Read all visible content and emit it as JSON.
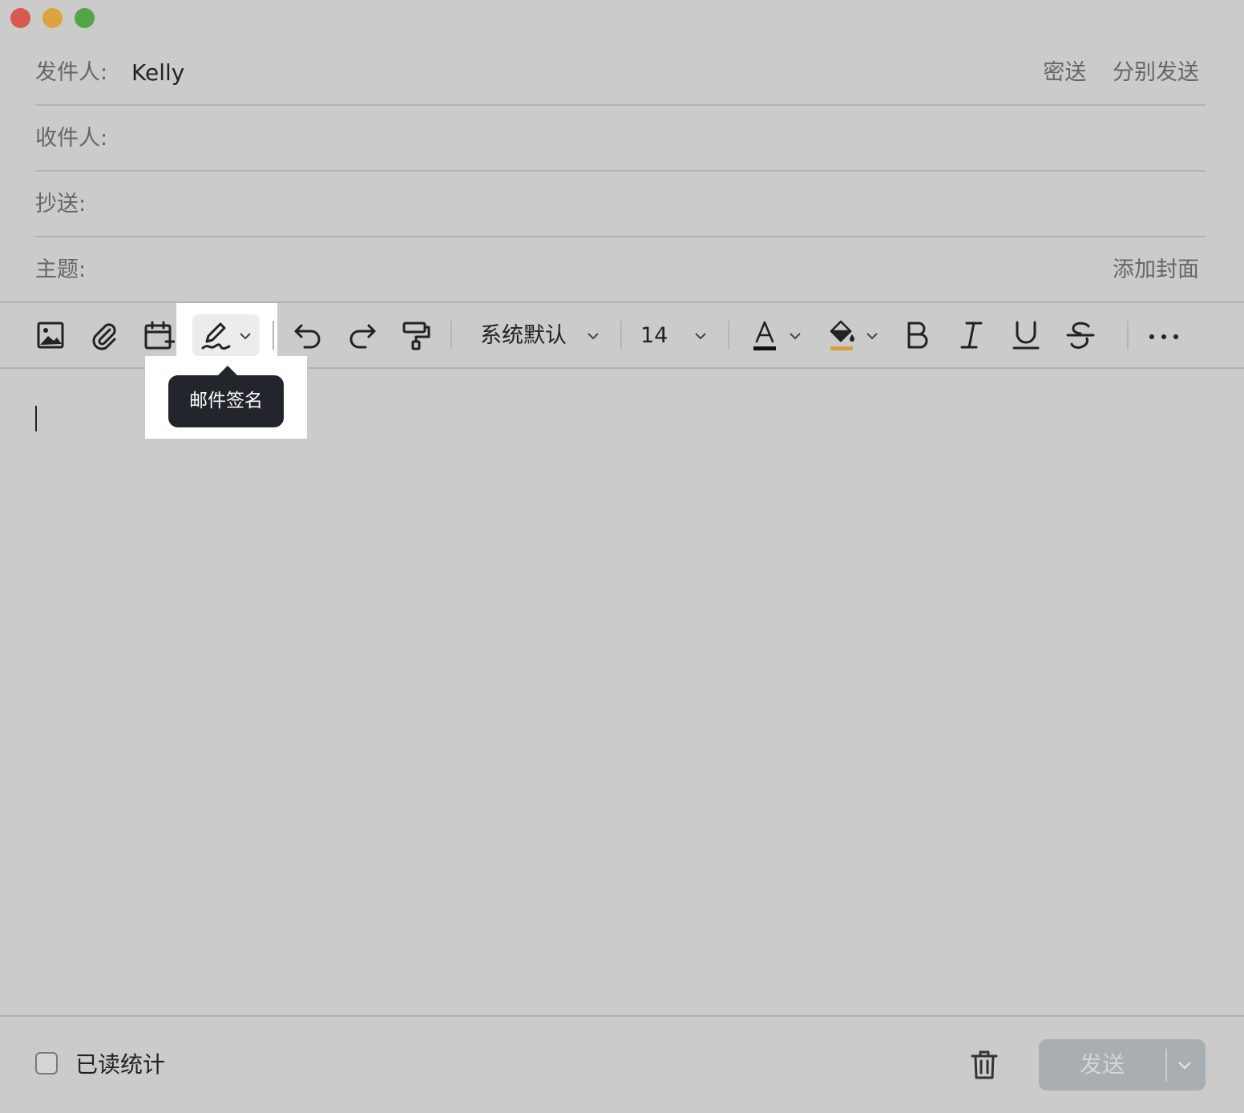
{
  "window": {
    "controls": [
      "close",
      "minimize",
      "maximize"
    ]
  },
  "header": {
    "from_label": "发件人:",
    "from_value": "Kelly",
    "bcc_link": "密送",
    "separate_send_link": "分别发送",
    "to_label": "收件人:",
    "cc_label": "抄送:",
    "subject_label": "主题:",
    "add_cover_link": "添加封面"
  },
  "toolbar": {
    "icons": [
      "image-icon",
      "attachment-icon",
      "calendar-add-icon",
      "signature-icon",
      "undo-icon",
      "redo-icon",
      "format-painter-icon",
      "font-color-icon",
      "highlight-icon",
      "bold-icon",
      "italic-icon",
      "underline-icon",
      "strikethrough-icon",
      "more-icon"
    ],
    "font_family": "系统默认",
    "font_size": "14",
    "font_color": "#111111",
    "highlight_color": "#d9a13b"
  },
  "tooltip": {
    "text": "邮件签名"
  },
  "footer": {
    "read_receipt_label": "已读统计",
    "read_receipt_checked": false,
    "send_label": "发送"
  },
  "colors": {
    "window_bg": "#cbcbcb",
    "tooltip_bg": "#23252c",
    "send_button_bg": "#a9aeb2"
  }
}
